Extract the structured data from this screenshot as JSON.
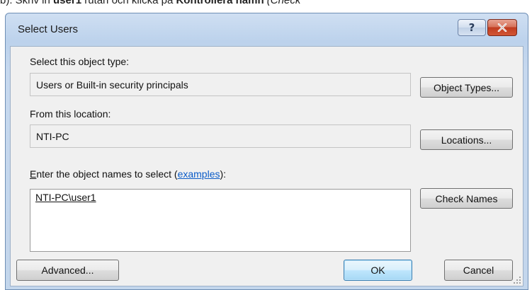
{
  "document": {
    "step_text": "b). Skriv in ",
    "bold_user": "user1",
    "mid_text": " rutan och klicka på ",
    "bold_check": "Kontrollera namn",
    "tail_text": " (Check"
  },
  "dialog": {
    "title": "Select Users",
    "help_glyph": "?",
    "object_type_label": "Select this object type:",
    "object_type_value": "Users or Built-in security principals",
    "object_types_button": "Object Types...",
    "location_label": "From this location:",
    "location_value": "NTI-PC",
    "locations_button": "Locations...",
    "names_label_first": "E",
    "names_label_rest": "nter the object names to select (",
    "names_label_link": "examples",
    "names_label_end": "):",
    "names_value": "NTI-PC\\user1",
    "check_names_button": "Check Names",
    "advanced_button": "Advanced...",
    "ok_button": "OK",
    "cancel_button": "Cancel"
  },
  "colors": {
    "titlebar": "#c3d6ec",
    "close": "#c03d20",
    "link": "#0b5cc8"
  },
  "icons": {
    "help": "question-mark-icon",
    "close": "close-x-icon",
    "resize": "resize-grip-icon"
  }
}
